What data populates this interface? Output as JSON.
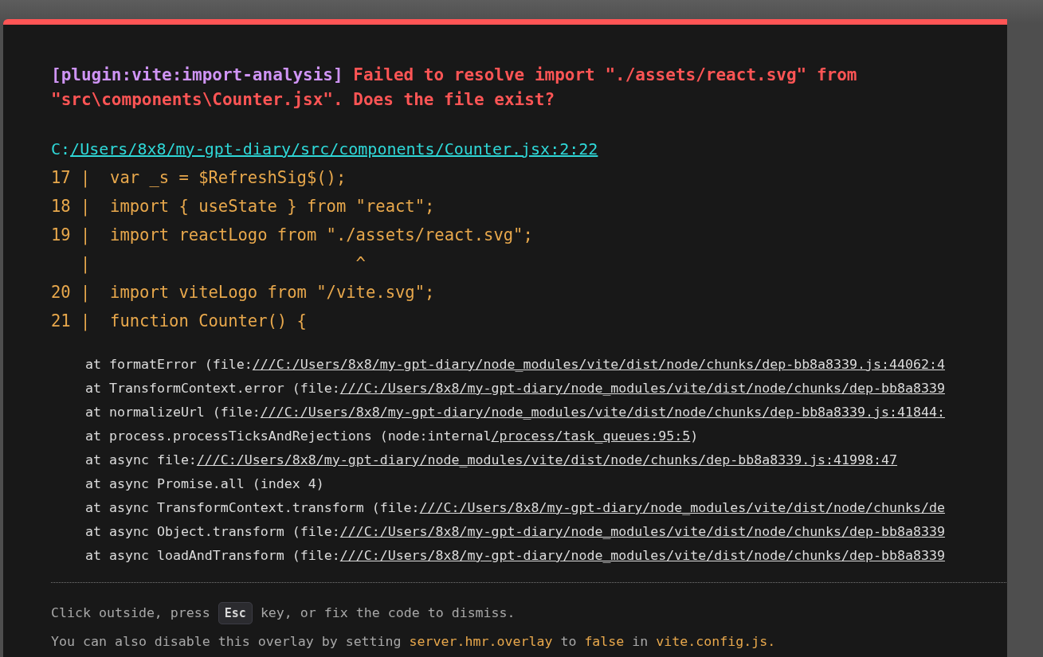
{
  "error": {
    "plugin": "[plugin:vite:import-analysis]",
    "message": "Failed to resolve import \"./assets/react.svg\" from \"src\\components\\Counter.jsx\". Does the file exist?"
  },
  "file": {
    "prefix": "C:",
    "link": "/Users/8x8/my-gpt-diary/src/components/Counter.jsx:2:22"
  },
  "frame": [
    "17 |  var _s = $RefreshSig$();",
    "18 |  import { useState } from \"react\";",
    "19 |  import reactLogo from \"./assets/react.svg\";",
    "   |                           ^",
    "20 |  import viteLogo from \"/vite.svg\";",
    "21 |  function Counter() {"
  ],
  "stack": [
    {
      "text": "at formatError (file:",
      "link": "///C:/Users/8x8/my-gpt-diary/node_modules/vite/dist/node/chunks/dep-bb8a8339.js:44062:4"
    },
    {
      "text": "at TransformContext.error (file:",
      "link": "///C:/Users/8x8/my-gpt-diary/node_modules/vite/dist/node/chunks/dep-bb8a8339"
    },
    {
      "text": "at normalizeUrl (file:",
      "link": "///C:/Users/8x8/my-gpt-diary/node_modules/vite/dist/node/chunks/dep-bb8a8339.js:41844:"
    },
    {
      "text": "at process.processTicksAndRejections (node:internal",
      "link": "/process/task_queues:95:5",
      "suffix": ")"
    },
    {
      "text": "at async file:",
      "link": "///C:/Users/8x8/my-gpt-diary/node_modules/vite/dist/node/chunks/dep-bb8a8339.js:41998:47"
    },
    {
      "text": "at async Promise.all (index 4)"
    },
    {
      "text": "at async TransformContext.transform (file:",
      "link": "///C:/Users/8x8/my-gpt-diary/node_modules/vite/dist/node/chunks/de"
    },
    {
      "text": "at async Object.transform (file:",
      "link": "///C:/Users/8x8/my-gpt-diary/node_modules/vite/dist/node/chunks/dep-bb8a8339"
    },
    {
      "text": "at async loadAndTransform (file:",
      "link": "///C:/Users/8x8/my-gpt-diary/node_modules/vite/dist/node/chunks/dep-bb8a8339"
    }
  ],
  "tip": {
    "before": "Click outside, press ",
    "key": "Esc",
    "after": " key, or fix the code to dismiss."
  },
  "tip2": [
    {
      "kind": "plain",
      "text": "You can also disable this overlay by setting "
    },
    {
      "kind": "code",
      "text": "server.hmr.overlay"
    },
    {
      "kind": "plain",
      "text": " to "
    },
    {
      "kind": "code",
      "text": "false"
    },
    {
      "kind": "plain",
      "text": " in "
    },
    {
      "kind": "code",
      "text": "vite.config.js."
    }
  ]
}
